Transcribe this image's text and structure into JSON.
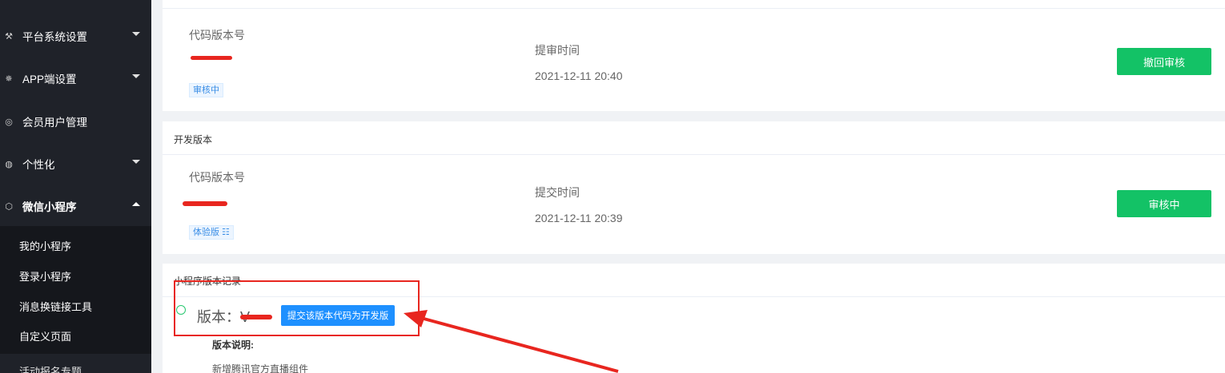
{
  "sidebar": {
    "menu": [
      {
        "icon": "tools-icon",
        "glyph": "⚒",
        "label": "平台系统设置",
        "expandable": true
      },
      {
        "icon": "gear-icon",
        "glyph": "✵",
        "label": "APP端设置",
        "expandable": true
      },
      {
        "icon": "shield-icon",
        "glyph": "◎",
        "label": "会员用户管理",
        "expandable": false
      },
      {
        "icon": "palette-icon",
        "glyph": "◍",
        "label": "个性化",
        "expandable": true
      },
      {
        "icon": "cube-icon",
        "glyph": "⬡",
        "label": "微信小程序",
        "expandable": true,
        "expanded": true
      }
    ],
    "submenu": [
      "我的小程序",
      "登录小程序",
      "消息换链接工具",
      "自定义页面"
    ],
    "cut_item": "活动报名专题"
  },
  "audit_card": {
    "code_version_label": "代码版本号",
    "status_tag": "审核中",
    "time_label": "提审时间",
    "time_value": "2021-12-11 20:40",
    "action_button": "撤回审核"
  },
  "dev_card": {
    "title": "开发版本",
    "code_version_label": "代码版本号",
    "tag": "体验版 ☷",
    "time_label": "提交时间",
    "time_value": "2021-12-11 20:39",
    "status_button": "审核中"
  },
  "history_card": {
    "title": "小程序版本记录",
    "version_prefix": "版本：V",
    "submit_button": "提交该版本代码为开发版",
    "note_title": "版本说明:",
    "note_text": "新增腾讯官方直播组件"
  },
  "colors": {
    "sidebar_bg": "#1f2229",
    "green": "#13c266",
    "blue": "#1e90ff",
    "annotation_red": "#e8261f"
  }
}
